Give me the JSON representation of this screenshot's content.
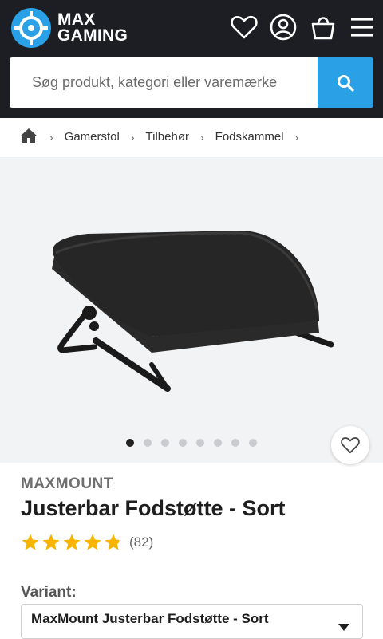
{
  "header": {
    "logo_line1": "MAX",
    "logo_line2": "GAMING",
    "icons": [
      "heart-icon",
      "user-icon",
      "bag-icon",
      "menu-icon"
    ]
  },
  "search": {
    "placeholder": "Søg produkt, kategori eller varemærke"
  },
  "breadcrumb": {
    "items": [
      "Gamerstol",
      "Tilbehør",
      "Fodskammel"
    ]
  },
  "gallery": {
    "image_count": 8,
    "active_index": 0
  },
  "product": {
    "brand": "MAXMOUNT",
    "title": "Justerbar Fodstøtte - Sort",
    "rating_value": 4.8,
    "rating_count": "(82)",
    "variant_label": "Variant:",
    "variant_selected": "MaxMount Justerbar Fodstøtte - Sort"
  },
  "colors": {
    "header_bg": "#1c1e23",
    "accent": "#2aa0e6",
    "star": "#f7b500"
  }
}
